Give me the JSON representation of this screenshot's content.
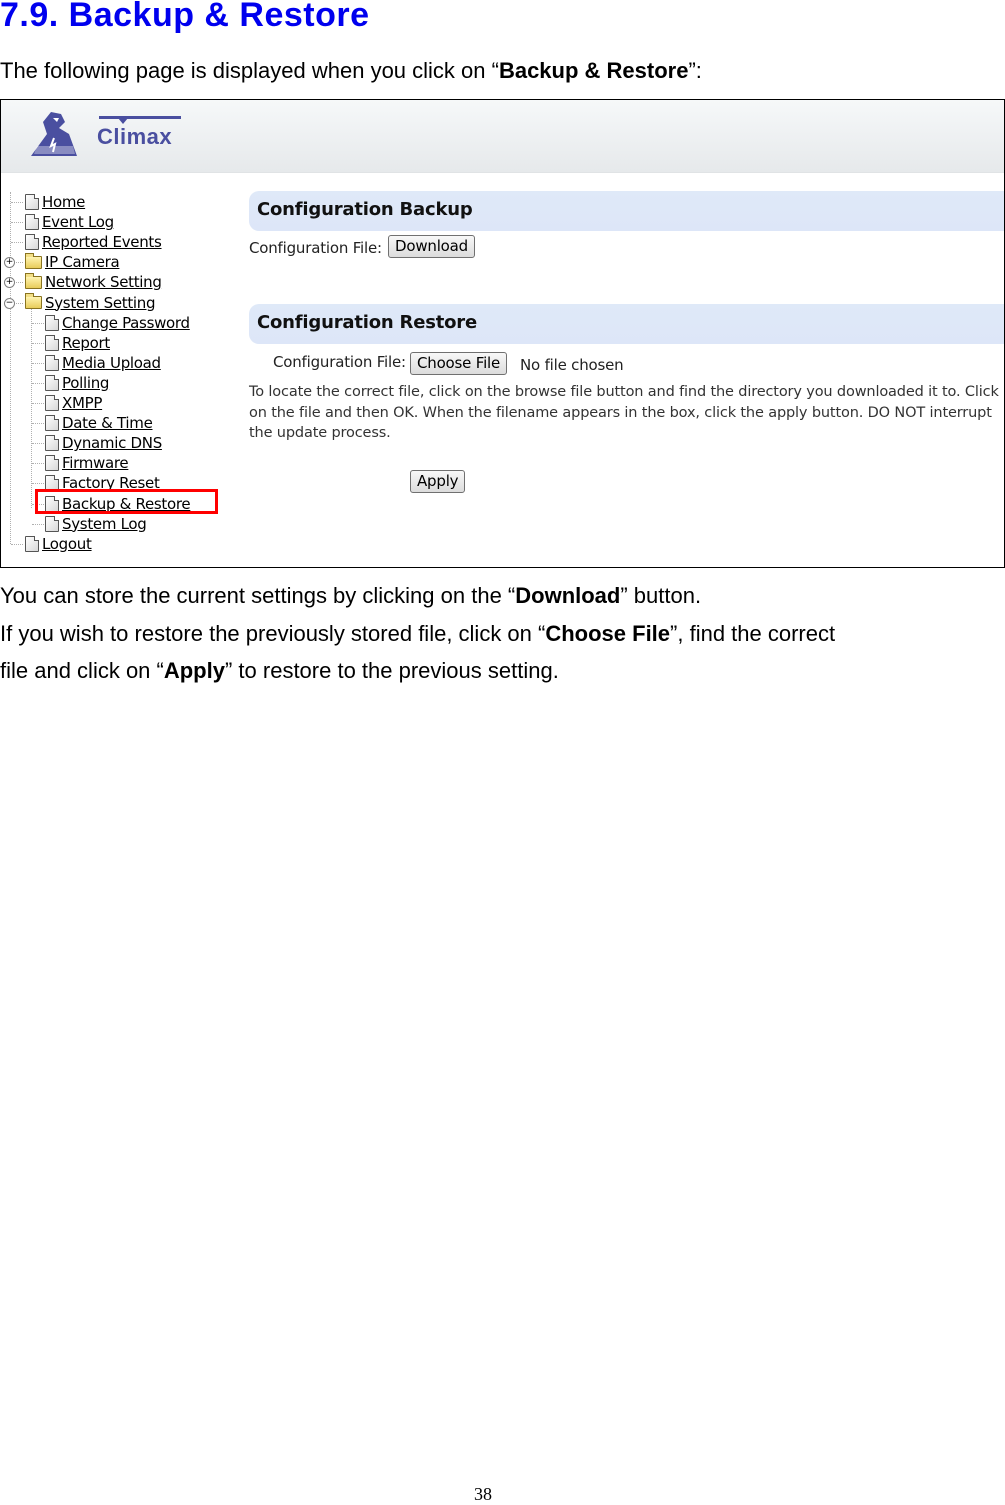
{
  "document": {
    "title": "7.9. Backup & Restore",
    "intro": {
      "prefix": "The following page is displayed when you click on “",
      "bold": "Backup & Restore",
      "suffix": "”:"
    },
    "paragraphs": [
      {
        "prefix": "You can store the current settings by clicking on the “",
        "bold": "Download",
        "suffix": "” button."
      },
      {
        "prefix": "If you wish to restore the previously stored file, click on “",
        "bold": "Choose File",
        "suffix": "”, find the correct"
      },
      {
        "prefix": "file and click on “",
        "bold": "Apply",
        "suffix": "” to restore to the previous setting."
      }
    ],
    "page_number": "38"
  },
  "screenshot": {
    "logo_text": "Climax",
    "nav": [
      {
        "label": "Home",
        "type": "page",
        "level": 0
      },
      {
        "label": "Event Log",
        "type": "page",
        "level": 0
      },
      {
        "label": "Reported Events",
        "type": "page",
        "level": 0
      },
      {
        "label": "IP Camera",
        "type": "folder",
        "level": 0,
        "toggle": "+"
      },
      {
        "label": "Network Setting",
        "type": "folder",
        "level": 0,
        "toggle": "+"
      },
      {
        "label": "System Setting",
        "type": "folder-open",
        "level": 0,
        "toggle": "−"
      },
      {
        "label": "Change Password",
        "type": "page",
        "level": 1
      },
      {
        "label": "Report",
        "type": "page",
        "level": 1
      },
      {
        "label": "Media Upload",
        "type": "page",
        "level": 1
      },
      {
        "label": "Polling",
        "type": "page",
        "level": 1
      },
      {
        "label": "XMPP",
        "type": "page",
        "level": 1
      },
      {
        "label": "Date & Time",
        "type": "page",
        "level": 1
      },
      {
        "label": "Dynamic DNS",
        "type": "page",
        "level": 1
      },
      {
        "label": "Firmware",
        "type": "page",
        "level": 1
      },
      {
        "label": "Factory Reset",
        "type": "page",
        "level": 1
      },
      {
        "label": "Backup & Restore",
        "type": "page",
        "level": 1,
        "highlighted": true
      },
      {
        "label": "System Log",
        "type": "page",
        "level": 1
      },
      {
        "label": "Logout",
        "type": "page",
        "level": 0
      }
    ],
    "backup": {
      "title": "Configuration Backup",
      "field_label": "Configuration File:",
      "button": "Download"
    },
    "restore": {
      "title": "Configuration Restore",
      "field_label": "Configuration File:",
      "choose_button": "Choose File",
      "file_status": "No file chosen",
      "help_text": "To locate the correct file, click on the browse file button and find the directory you downloaded it to. Click on the file and then OK. When the filename appears in the box, click the apply button. DO NOT interrupt the update process.",
      "apply_button": "Apply"
    },
    "colors": {
      "highlight": "#ff0000",
      "section_bar": "#dde6f8",
      "title_blue": "#0000ee",
      "logo": "#4a4fa0"
    }
  }
}
